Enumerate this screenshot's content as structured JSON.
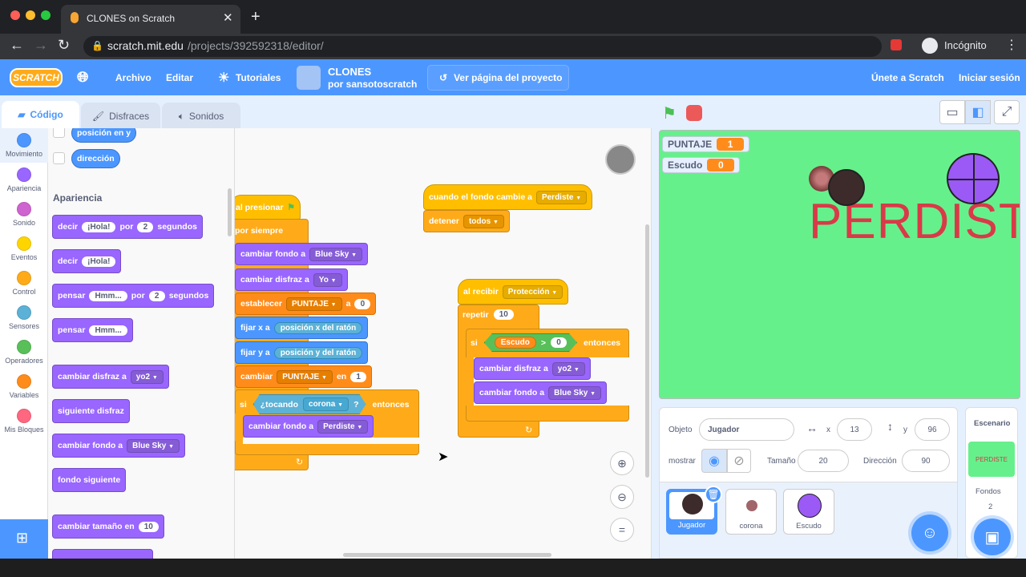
{
  "browser": {
    "tab_title": "CLONES on Scratch",
    "url_host": "scratch.mit.edu",
    "url_path": "/projects/392592318/editor/",
    "profile_label": "Incógnito"
  },
  "menu": {
    "logo": "SCRATCH",
    "file": "Archivo",
    "edit": "Editar",
    "tutorials": "Tutoriales",
    "project_title": "CLONES",
    "project_author": "por sansotoscratch",
    "see_project": "Ver página del proyecto",
    "join": "Únete a Scratch",
    "sign_in": "Iniciar sesión"
  },
  "editor_tabs": {
    "code": "Código",
    "costumes": "Disfraces",
    "sounds": "Sonidos"
  },
  "categories": [
    {
      "label": "Movimiento",
      "color": "#4c97ff"
    },
    {
      "label": "Apariencia",
      "color": "#9966ff"
    },
    {
      "label": "Sonido",
      "color": "#cf63cf"
    },
    {
      "label": "Eventos",
      "color": "#ffd500"
    },
    {
      "label": "Control",
      "color": "#ffab19"
    },
    {
      "label": "Sensores",
      "color": "#5cb1d6"
    },
    {
      "label": "Operadores",
      "color": "#59c059"
    },
    {
      "label": "Variables",
      "color": "#ff8c1a"
    },
    {
      "label": "Mis Bloques",
      "color": "#ff6680"
    }
  ],
  "palette": {
    "motion_reporters": [
      "posición en y",
      "dirección"
    ],
    "section_title": "Apariencia",
    "say_secs": {
      "a": "decir",
      "msg": "¡Hola!",
      "b": "por",
      "secs": "2",
      "c": "segundos"
    },
    "say": {
      "a": "decir",
      "msg": "¡Hola!"
    },
    "think_secs": {
      "a": "pensar",
      "msg": "Hmm...",
      "b": "por",
      "secs": "2",
      "c": "segundos"
    },
    "think": {
      "a": "pensar",
      "msg": "Hmm..."
    },
    "switch_costume": {
      "a": "cambiar disfraz a",
      "v": "yo2"
    },
    "next_costume": "siguiente disfraz",
    "switch_backdrop": {
      "a": "cambiar fondo a",
      "v": "Blue Sky"
    },
    "next_backdrop": "fondo siguiente",
    "change_size": {
      "a": "cambiar tamaño en",
      "v": "10"
    }
  },
  "script1": {
    "hat": "al presionar",
    "forever": "por siempre",
    "b1": {
      "a": "cambiar fondo a",
      "v": "Blue Sky"
    },
    "b2": {
      "a": "cambiar disfraz a",
      "v": "Yo"
    },
    "b3": {
      "a": "establecer",
      "var": "PUNTAJE",
      "b": "a",
      "v": "0"
    },
    "b4": {
      "a": "fijar x a",
      "v": "posición x del ratón"
    },
    "b5": {
      "a": "fijar y a",
      "v": "posición y del ratón"
    },
    "b6": {
      "a": "cambiar",
      "var": "PUNTAJE",
      "b": "en",
      "v": "1"
    },
    "if": {
      "a": "si",
      "cond": "¿tocando",
      "obj": "corona",
      "q": "?",
      "then": "entonces"
    },
    "b7": {
      "a": "cambiar fondo a",
      "v": "Perdiste"
    }
  },
  "script2": {
    "hat": "cuando el fondo cambie a",
    "hat_v": "Perdiste",
    "stop": "detener",
    "stop_v": "todos"
  },
  "script3": {
    "hat": "al recibir",
    "hat_v": "Protección",
    "repeat": "repetir",
    "repeat_v": "10",
    "if": "si",
    "var": "Escudo",
    "op": ">",
    "cmp": "0",
    "then": "entonces",
    "b1": {
      "a": "cambiar disfraz a",
      "v": "yo2"
    },
    "b2": {
      "a": "cambiar fondo a",
      "v": "Blue Sky"
    }
  },
  "stage": {
    "monitors": [
      {
        "label": "PUNTAJE",
        "value": "1"
      },
      {
        "label": "Escudo",
        "value": "0"
      }
    ],
    "text": "PERDISTE"
  },
  "sprite_info": {
    "sprite_label": "Objeto",
    "sprite_name": "Jugador",
    "x_label": "x",
    "x": "13",
    "y_label": "y",
    "y": "96",
    "show_label": "mostrar",
    "size_label": "Tamaño",
    "size": "20",
    "direction_label": "Dirección",
    "direction": "90"
  },
  "sprites": [
    "Jugador",
    "corona",
    "Escudo"
  ],
  "stage_target": {
    "title": "Escenario",
    "thumb": "PERDISTE",
    "backdrops_label": "Fondos",
    "backdrops_count": "2"
  }
}
